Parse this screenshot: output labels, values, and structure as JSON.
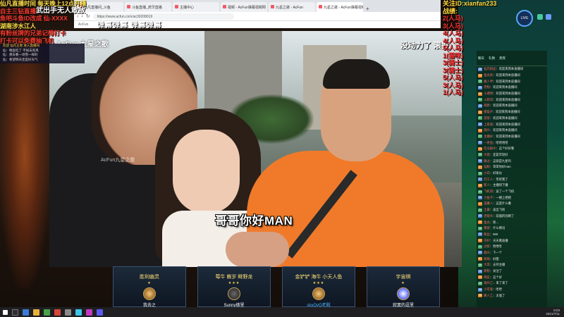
{
  "browser": {
    "tabs": [
      "仙凡直播间_斗鱼",
      "斗鱼直播_虎牙直播",
      "主播中心",
      "视频 - AcFun弹幕视频网",
      "九星之歌 - AcFun",
      "九星之歌 - AcFun弹幕视频网"
    ],
    "url": "https://www.acfun.cn/v/ac30208019",
    "bookmark": "AcFun"
  },
  "video": {
    "logo": "AcFun 九星之歌",
    "watermark": "AcFun九星之歌",
    "top_right_caption": "没动力了 滚投",
    "subtitle": "哥哥你好MAN",
    "danmaku": "弹幕弹幕 弹幕弹幕"
  },
  "left_overlay": {
    "lines": [
      "仙凡直播时间 每天晚上12点开播",
      "自主三钻直播",
      "鱼吧斗鱼ID改成 仙-XXXX",
      "湖南涉水江人",
      "有粉丝牌的兄弟记得打卡",
      "打卡可以免费抽飞机"
    ],
    "title": "武出手无人敢敌"
  },
  "mini_chat": [
    "欢迎 仙凡王者 进入直播间",
    "仙：晚饭吃了 不如去兜风",
    "仙：想去看一场雪一样的",
    "仙：希望明天还是好天气"
  ],
  "right_overlay": {
    "header": "关注ID:xianfan233",
    "title": "战绩:",
    "items": [
      "2(人马)",
      "3(人马)",
      "4(人马)",
      "4(人马)",
      "5(人马)",
      "1(猫咪)",
      "3(骑士)",
      "3(骑士)",
      "5(人马)",
      "3(人马)",
      "1(人马)"
    ],
    "badge": "LIVE"
  },
  "chat": {
    "tabs": [
      "聊天",
      "礼物",
      "贵宾"
    ],
    "messages": [
      {
        "level": "28",
        "name": "仙凡粉丝",
        "text": "欢迎来到本直播间"
      },
      {
        "level": "12",
        "name": "鱼丸侠",
        "text": "欢迎来到本直播间"
      },
      {
        "level": "15",
        "name": "路人甲",
        "text": "欢迎来到本直播间"
      },
      {
        "level": "09",
        "name": "老粉",
        "text": "欢迎来到本直播间"
      },
      {
        "level": "20",
        "name": "小透明",
        "text": "欢迎来到本直播间"
      },
      {
        "level": "31",
        "name": "火箭哥",
        "text": "欢迎来到本直播间"
      },
      {
        "level": "18",
        "name": "萌新",
        "text": "欢迎来到本直播间"
      },
      {
        "level": "11",
        "name": "夜猫子",
        "text": "欢迎来到本直播间"
      },
      {
        "level": "07",
        "name": "游客",
        "text": "欢迎来到本直播间"
      },
      {
        "level": "26",
        "name": "上班族",
        "text": "欢迎来到本直播间"
      },
      {
        "level": "14",
        "name": "观众",
        "text": "欢迎来到本直播间"
      },
      {
        "level": "22",
        "name": "主播好",
        "text": "欢迎来到本直播间"
      },
      {
        "level": "05",
        "name": "一条鱼",
        "text": "哈哈哈哈"
      },
      {
        "level": "19",
        "name": "吃瓜群众",
        "text": "这个好好看"
      },
      {
        "level": "13",
        "name": "大佬",
        "text": "还是年轻好"
      },
      {
        "level": "08",
        "name": "路过",
        "text": "这就是九星吗"
      },
      {
        "level": "27",
        "name": "仙粉",
        "text": "哥哥你好man"
      },
      {
        "level": "16",
        "name": "小白",
        "text": "好家伙"
      },
      {
        "level": "21",
        "name": "打工人",
        "text": "笑死我了"
      },
      {
        "level": "10",
        "name": "新人",
        "text": "主播快下播"
      },
      {
        "level": "24",
        "name": "飞机哥",
        "text": "送了一个飞机"
      },
      {
        "level": "06",
        "name": "小鱼干",
        "text": "一楼上把把"
      },
      {
        "level": "17",
        "name": "追番人",
        "text": "这是什么番"
      },
      {
        "level": "29",
        "name": "土豪",
        "text": "送出飞机"
      },
      {
        "level": "12",
        "name": "老观众",
        "text": "前面的别刷了"
      },
      {
        "level": "09",
        "name": "鱼丸",
        "text": "呃..."
      },
      {
        "level": "18",
        "name": "看客",
        "text": "什么情况"
      },
      {
        "level": "14",
        "name": "粉丝",
        "text": "666"
      },
      {
        "level": "23",
        "name": "守护",
        "text": "天天看直播"
      },
      {
        "level": "11",
        "name": "过客",
        "text": "哈哈哈"
      },
      {
        "level": "20",
        "name": "群众",
        "text": "下一个"
      },
      {
        "level": "07",
        "name": "萌萌",
        "text": "好甜"
      },
      {
        "level": "25",
        "name": "大哥",
        "text": "支持主播"
      },
      {
        "level": "15",
        "name": "新粉",
        "text": "关注了"
      },
      {
        "level": "13",
        "name": "网友",
        "text": "这个好"
      },
      {
        "level": "19",
        "name": "观众乙",
        "text": "来了来了"
      },
      {
        "level": "08",
        "name": "小可爱",
        "text": "哈哈"
      },
      {
        "level": "16",
        "name": "路人乙",
        "text": "太强了"
      }
    ]
  },
  "cards": [
    {
      "title": "胜利幽灵",
      "stars": "★",
      "player": "我去之"
    },
    {
      "title": "莓牛 赖岁 眸野龙",
      "stars": "★★★",
      "player": "Sunny德里"
    },
    {
      "title": "金铲铲 海牛 小天人鱼",
      "stars": "★★★",
      "player": "skyQvQ老贼"
    },
    {
      "title": "宇宙棋",
      "stars": "★",
      "player": "寂寞的逗里"
    }
  ],
  "taskbar": {
    "time": "8:03",
    "date": "2021/7/11"
  }
}
